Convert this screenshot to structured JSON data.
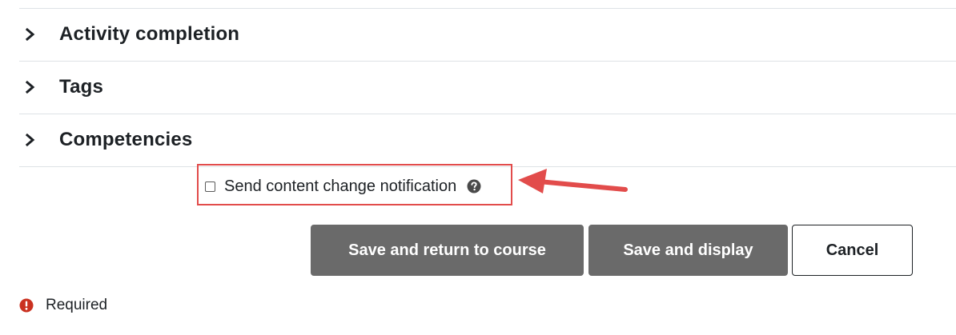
{
  "sections": [
    {
      "label": "Activity completion",
      "icon": "chevron-right-icon"
    },
    {
      "label": "Tags",
      "icon": "chevron-right-icon"
    },
    {
      "label": "Competencies",
      "icon": "chevron-right-icon"
    }
  ],
  "notification": {
    "label": "Send content change notification",
    "checked": false,
    "help_icon": "question-circle-icon",
    "highlight_color": "#e24c4b"
  },
  "buttons": {
    "save_return": "Save and return to course",
    "save_display": "Save and display",
    "cancel": "Cancel"
  },
  "required": {
    "icon": "exclamation-circle-icon",
    "label": "Required",
    "icon_color": "#ca3120"
  },
  "colors": {
    "primary_button": "#6a6a6a",
    "annotation_red": "#e24c4b"
  }
}
